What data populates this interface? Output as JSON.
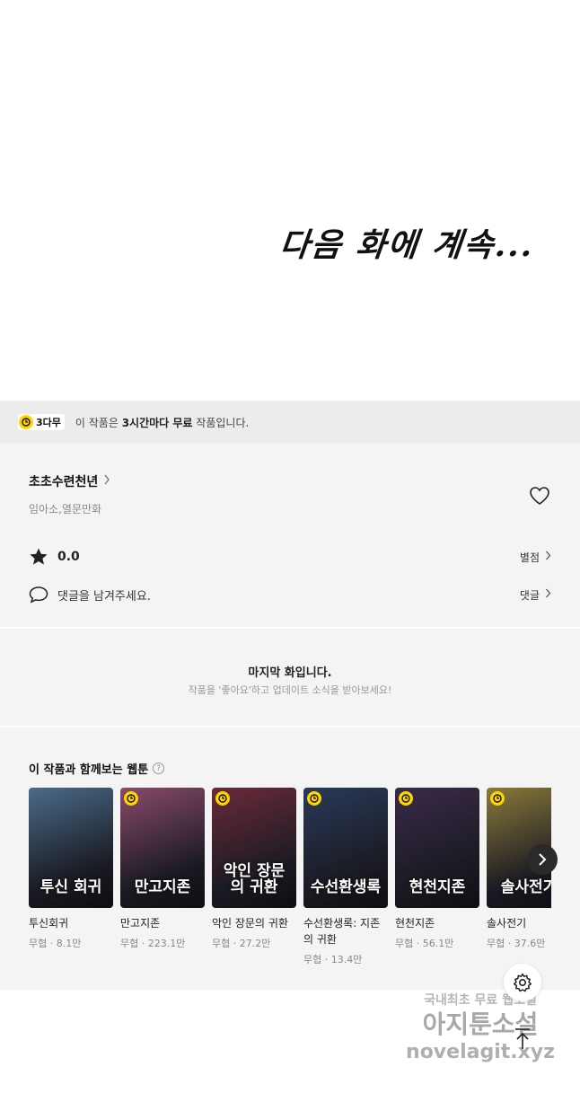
{
  "episode": {
    "ending_text": "다음 화에 계속..."
  },
  "free_banner": {
    "badge": "3다무",
    "text_prefix": "이 작품은 ",
    "text_bold": "3시간마다 무료",
    "text_suffix": " 작품입니다."
  },
  "series": {
    "title": "초초수련천년",
    "authors": "임아소,열문만화",
    "rating": "0.0",
    "rate_link": "별점",
    "comment_prompt": "댓글을 남겨주세요.",
    "comment_link": "댓글"
  },
  "last_episode": {
    "title": "마지막 화입니다.",
    "subtitle": "작품을 '좋아요'하고 업데이트 소식을 받아보세요!"
  },
  "recommendations": {
    "heading": "이 작품과 함께보는 웹툰",
    "help_icon": "?",
    "items": [
      {
        "name": "투신회귀",
        "genre": "무협",
        "views": "8.1만",
        "art": "투신 회귀",
        "free_clock": false,
        "color": "#4a6b8a"
      },
      {
        "name": "만고지존",
        "genre": "무협",
        "views": "223.1만",
        "art": "만고지존",
        "free_clock": true,
        "color": "#8a4a6b"
      },
      {
        "name": "악인 장문의 귀환",
        "genre": "무협",
        "views": "27.2만",
        "art": "악인 장문의 귀환",
        "free_clock": true,
        "color": "#6b2a3a"
      },
      {
        "name": "수선환생록: 지존의 귀환",
        "genre": "무협",
        "views": "13.4만",
        "art": "수선환생록",
        "free_clock": true,
        "color": "#2a3a5a"
      },
      {
        "name": "현천지존",
        "genre": "무협",
        "views": "56.1만",
        "art": "현천지존",
        "free_clock": true,
        "color": "#3a2a4a"
      },
      {
        "name": "솔사전기",
        "genre": "무협",
        "views": "37.6만",
        "art": "솔사전기",
        "free_clock": true,
        "color": "#8a7a3a"
      }
    ]
  },
  "watermark": {
    "line1": "국내최초 무료 웹소설",
    "line2": "아지툰소설",
    "line3": "novelagit.xyz"
  },
  "colors": {
    "clock_yellow": "#ffd400",
    "panel_gray": "#f4f4f4",
    "banner_gray": "#ececec"
  }
}
